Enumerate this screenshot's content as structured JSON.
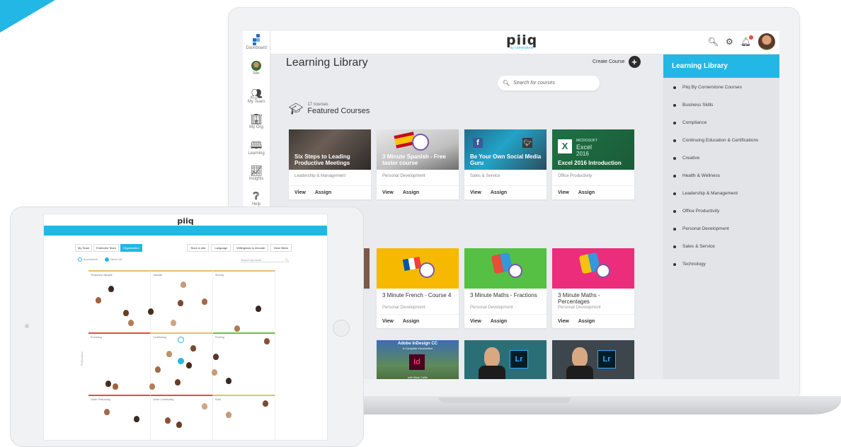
{
  "colors": {
    "accent": "#23b7e5",
    "dark": "#2d2d2d"
  },
  "laptop": {
    "logo": {
      "main": "piiq",
      "sub": "by cornerstone"
    },
    "top_icons": [
      "search-icon",
      "gear-icon",
      "bell-icon",
      "user-avatar"
    ],
    "nav": [
      {
        "label": "Dashboard",
        "icon": "dashboard-icon"
      },
      {
        "label": "Me",
        "icon": "me-avatar"
      },
      {
        "label": "My Team",
        "icon": "team-icon"
      },
      {
        "label": "My Org",
        "icon": "org-icon"
      },
      {
        "label": "Learning",
        "icon": "book-icon"
      },
      {
        "label": "Insights",
        "icon": "chart-icon"
      },
      {
        "label": "Help",
        "icon": "help-icon"
      }
    ],
    "page_title": "Learning Library",
    "create_course": "Create Course",
    "create_course_plus": "+",
    "search_placeholder": "Search for courses",
    "featured": {
      "count": "17 courses",
      "title": "Featured Courses"
    },
    "card_actions": {
      "view": "View",
      "assign": "Assign"
    },
    "featured_cards": [
      {
        "title": "Six Steps to Leading Productive Meetings",
        "category": "Leadership & Management",
        "badge": ""
      },
      {
        "title": "3 Minute Spanish - Free taster course",
        "category": "Personal Development",
        "badge": ""
      },
      {
        "title": "Be Your Own Social Media Guru",
        "category": "Sales & Service",
        "badge": ""
      },
      {
        "title": "Excel 2016 Introduction",
        "category": "Office Productivity",
        "badge": "MICROSOFT",
        "sub": "Excel",
        "year": "2016"
      }
    ],
    "second_cards": [
      {
        "title": "3 Minute French - Course 4",
        "category": "Personal Development"
      },
      {
        "title": "3 Minute Maths - Fractions",
        "category": "Personal Development"
      },
      {
        "title": "3 Minute Maths - Percentages",
        "category": "Personal Development"
      }
    ],
    "third_cards": [
      {
        "title": "Adobe InDesign CC",
        "subtitle": "A Complete Introduction",
        "logo": "Id",
        "author": "with Mark Callie"
      },
      {
        "logo": "Lr"
      },
      {
        "logo": "Lr"
      }
    ],
    "sidebar": {
      "title": "Learning Library",
      "items": [
        "Piiq By Cornerstone Courses",
        "Business Skills",
        "Compliance",
        "Continuing Education & Certifications",
        "Creative",
        "Health & Wellness",
        "Leadership & Management",
        "Office Productivity",
        "Personal Development",
        "Sales & Service",
        "Technology"
      ]
    }
  },
  "tablet": {
    "logo": "piiq",
    "tabs": [
      "My Team",
      "Extended Team",
      "Organization"
    ],
    "filters": [
      "Team in site",
      "Language",
      "Willingness to relocate",
      "More filters"
    ],
    "radios": [
      "Successions",
      "Talent Grid"
    ],
    "search_placeholder": "Search by name",
    "axis_label": "Performance",
    "cells": [
      "Temporary Valuable",
      "Valuable",
      "Shining",
      "Promising",
      "Contributing",
      "Pushing",
      "Under Performing",
      "Under Contributing",
      "Solid"
    ]
  }
}
